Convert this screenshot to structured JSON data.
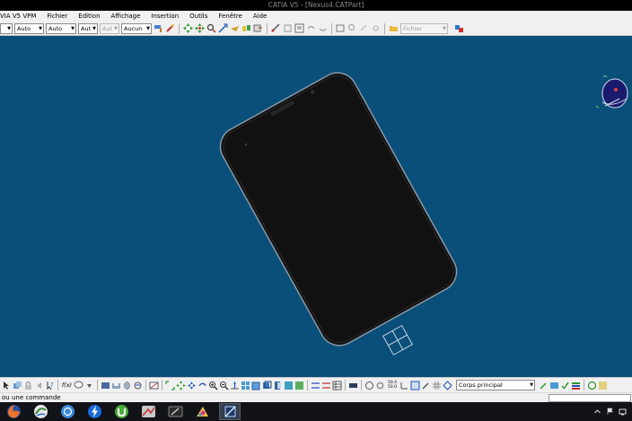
{
  "window": {
    "title": "CATIA V5 - [Nexus4.CATPart]"
  },
  "menu": {
    "items": [
      "VIA V5 VPM",
      "Fichier",
      "Edition",
      "Affichage",
      "Insertion",
      "Outils",
      "Fenêtre",
      "Aide"
    ]
  },
  "top_toolbar": {
    "combos": [
      "Auto",
      "Auto",
      "Aut",
      "Aut",
      "Aucun"
    ],
    "file_combo": "Fichier"
  },
  "bottom_toolbar": {
    "fx_label": "f(x)",
    "body_combo": "Corps principal",
    "ratio_top": "50.4",
    "ratio_bottom": "50.0"
  },
  "status": {
    "text": "ou une commande"
  },
  "colors": {
    "viewport": "#0a4f7a",
    "phone_body": "#111111",
    "phone_edge": "#8a9aa8",
    "compass": "#1a1a6e"
  },
  "taskbar": {
    "icons": [
      "firefox-icon",
      "swirl-app-icon",
      "itunes-icon",
      "lightning-app-icon",
      "utorrent-icon",
      "media-app-icon",
      "drawing-tablet-icon",
      "paint-app-icon",
      "catia-task-icon"
    ]
  }
}
